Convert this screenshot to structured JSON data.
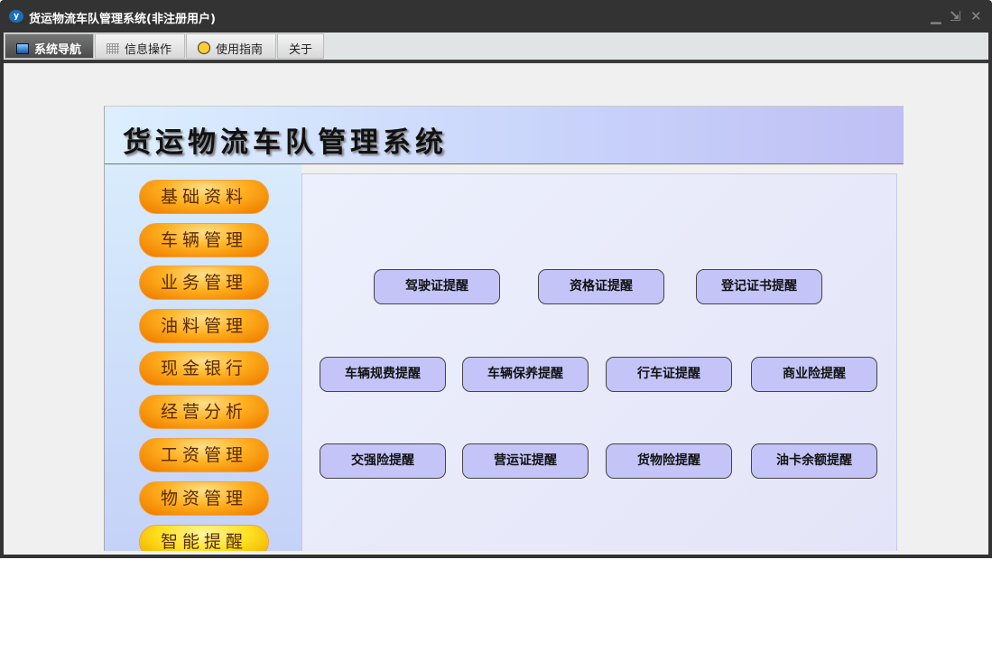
{
  "window": {
    "title": "货运物流车队管理系统(非注册用户)",
    "controls": {
      "minimize": "▁",
      "restore": "⇲",
      "close": "✕"
    }
  },
  "tabs": [
    {
      "label": "系统导航",
      "icon": "monitor-icon"
    },
    {
      "label": "信息操作",
      "icon": "grid-icon"
    },
    {
      "label": "使用指南",
      "icon": "help-icon"
    },
    {
      "label": "关于"
    }
  ],
  "header": {
    "title": "货运物流车队管理系统"
  },
  "sidebar": [
    "基础资料",
    "车辆管理",
    "业务管理",
    "油料管理",
    "现金银行",
    "经营分析",
    "工资管理",
    "物资管理",
    "智能提醒"
  ],
  "reminders": {
    "row1": [
      "驾驶证提醒",
      "资格证提醒",
      "登记证书提醒"
    ],
    "row2": [
      "车辆规费提醒",
      "车辆保养提醒",
      "行车证提醒",
      "商业险提醒"
    ],
    "row3": [
      "交强险提醒",
      "营运证提醒",
      "货物险提醒",
      "油卡余额提醒"
    ]
  }
}
